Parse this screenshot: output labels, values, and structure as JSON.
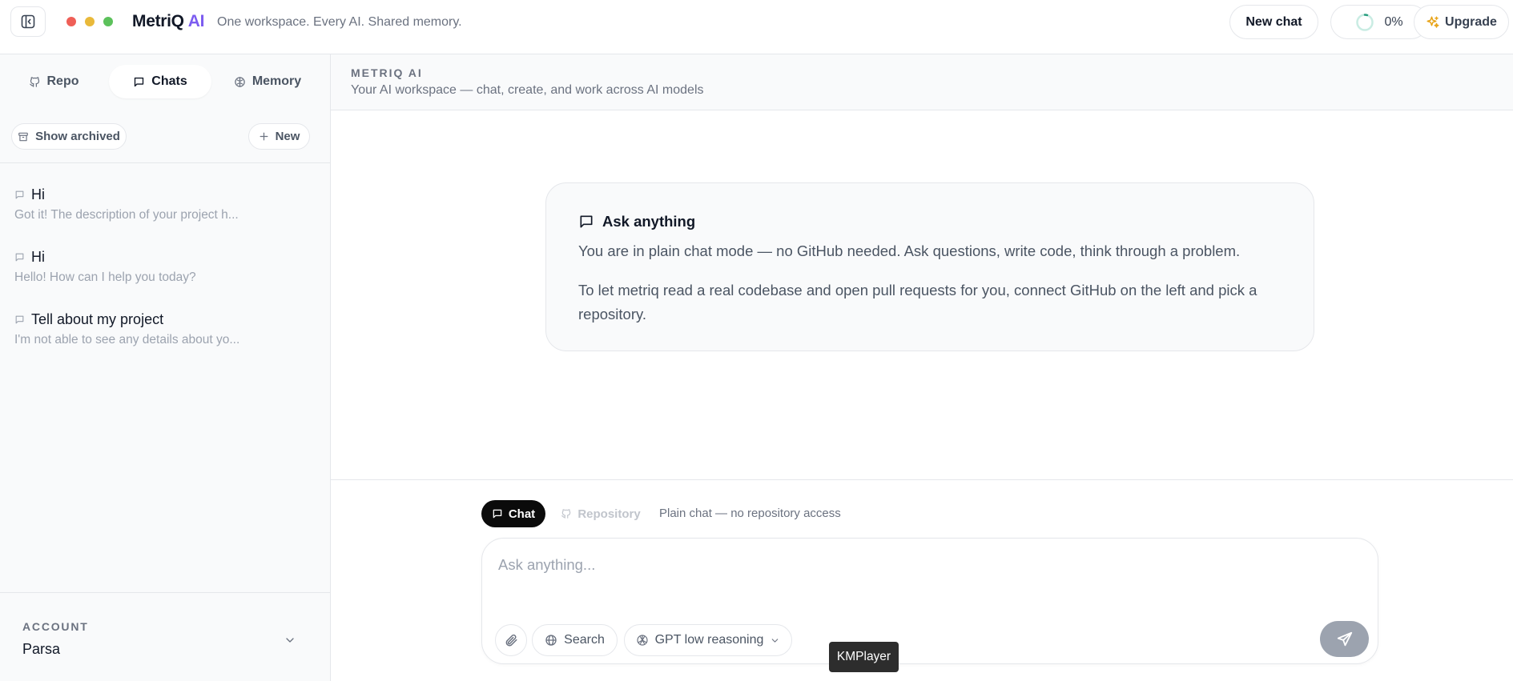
{
  "app": {
    "brand_name": "MetriQ",
    "brand_accent": "AI",
    "tagline": "One workspace. Every AI. Shared memory.",
    "accent_color": "#7c5cf0"
  },
  "topbar": {
    "new_chat_label": "New chat",
    "usage_percent_label": "0%",
    "usage_progress": 0.05,
    "upgrade_label": "Upgrade"
  },
  "sidebar": {
    "tabs": [
      {
        "label": "Repo",
        "icon": "github-icon",
        "active": false
      },
      {
        "label": "Chats",
        "icon": "chat-bubble-icon",
        "active": true
      },
      {
        "label": "Memory",
        "icon": "brain-icon",
        "active": false
      }
    ],
    "show_archived_label": "Show archived",
    "new_label": "New",
    "chats": [
      {
        "title": "Hi",
        "preview": "Got it! The description of your project h..."
      },
      {
        "title": "Hi",
        "preview": "Hello! How can I help you today?"
      },
      {
        "title": "Tell about my project",
        "preview": "I'm not able to see any details about yo..."
      }
    ],
    "account_label": "ACCOUNT",
    "account_name": "Parsa"
  },
  "main": {
    "header_label": "METRIQ AI",
    "header_subtitle": "Your AI workspace — chat, create, and work across AI models",
    "card": {
      "title": "Ask anything",
      "paragraph1": "You are in plain chat mode — no GitHub needed. Ask questions, write code, think through a problem.",
      "paragraph2": "To let metriq read a real codebase and open pull requests for you, connect GitHub on the left and pick a repository."
    }
  },
  "composer": {
    "mode_chat_label": "Chat",
    "mode_repo_label": "Repository",
    "mode_description": "Plain chat — no repository access",
    "placeholder": "Ask anything...",
    "value": "",
    "search_label": "Search",
    "model_label": "GPT low reasoning"
  },
  "tooltip": {
    "text": "KMPlayer"
  }
}
